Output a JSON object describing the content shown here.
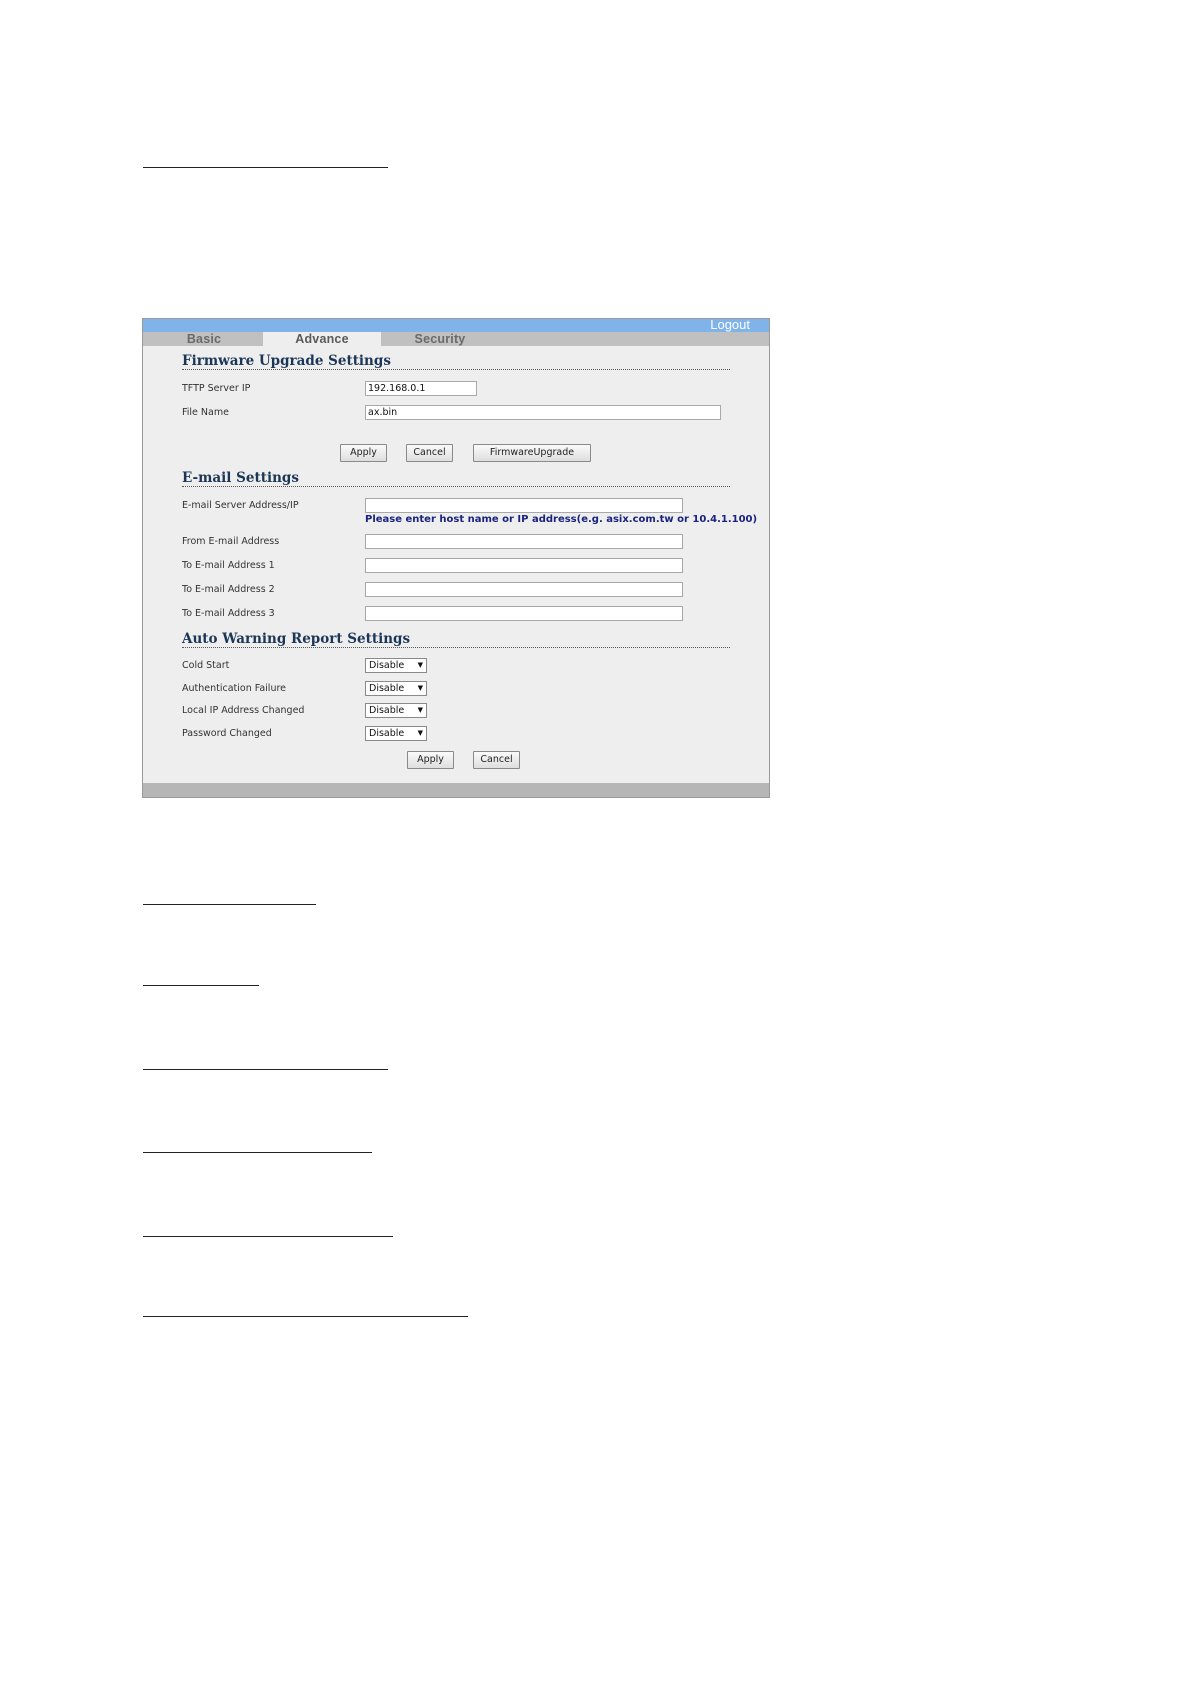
{
  "header": {
    "logout_label": "Logout"
  },
  "tabs": [
    {
      "label": "Basic",
      "active": false
    },
    {
      "label": "Advance",
      "active": true
    },
    {
      "label": "Security",
      "active": false
    }
  ],
  "firmware": {
    "title": "Firmware Upgrade Settings",
    "tftp_label": "TFTP Server IP",
    "tftp_value": "192.168.0.1",
    "file_label": "File Name",
    "file_value": "ax.bin",
    "apply_label": "Apply",
    "cancel_label": "Cancel",
    "upgrade_label": "FirmwareUpgrade"
  },
  "email": {
    "title": "E-mail Settings",
    "server_label": "E-mail Server Address/IP",
    "server_value": "",
    "hint": "Please enter host name or IP address(e.g. asix.com.tw or 10.4.1.100)",
    "from_label": "From E-mail Address",
    "from_value": "",
    "to1_label": "To E-mail Address 1",
    "to1_value": "",
    "to2_label": "To E-mail Address 2",
    "to2_value": "",
    "to3_label": "To E-mail Address 3",
    "to3_value": ""
  },
  "warning": {
    "title": "Auto Warning Report Settings",
    "items": [
      {
        "label": "Cold Start",
        "value": "Disable"
      },
      {
        "label": "Authentication Failure",
        "value": "Disable"
      },
      {
        "label": "Local IP Address Changed",
        "value": "Disable"
      },
      {
        "label": "Password Changed",
        "value": "Disable"
      }
    ],
    "apply_label": "Apply",
    "cancel_label": "Cancel"
  },
  "colors": {
    "topbar": "#7fb3ea",
    "section_title": "#1c3656",
    "hint": "#1a237e"
  }
}
